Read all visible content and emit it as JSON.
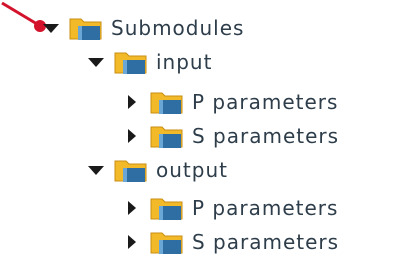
{
  "tree": {
    "root": {
      "label": "Submodules",
      "state": "expanded",
      "icon": "folder-module-icon"
    },
    "input": {
      "label": "input",
      "state": "expanded",
      "icon": "folder-module-icon"
    },
    "input_p": {
      "label": "P parameters",
      "state": "collapsed",
      "icon": "folder-module-icon"
    },
    "input_s": {
      "label": "S parameters",
      "state": "collapsed",
      "icon": "folder-module-icon"
    },
    "output": {
      "label": "output",
      "state": "expanded",
      "icon": "folder-module-icon"
    },
    "output_p": {
      "label": "P parameters",
      "state": "collapsed",
      "icon": "folder-module-icon"
    },
    "output_s": {
      "label": "S parameters",
      "state": "collapsed",
      "icon": "folder-module-icon"
    }
  },
  "colors": {
    "folder_fill": "#f2b928",
    "folder_dark": "#c98e12",
    "module_blue": "#2f6ea3",
    "pointer_red": "#d3132b",
    "text": "#2e3d4a"
  }
}
